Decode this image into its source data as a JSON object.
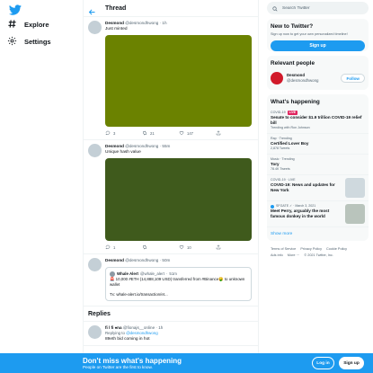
{
  "nav": {
    "logo_icon": "twitter-bird-icon",
    "items": [
      {
        "label": "Explore",
        "icon": "hashtag-icon"
      },
      {
        "label": "Settings",
        "icon": "gear-icon"
      }
    ]
  },
  "header": {
    "title": "Thread"
  },
  "tweets": [
    {
      "name": "Desmond",
      "handle": "@desmondhwong",
      "time": "1h",
      "text": "Just minted",
      "media_color": "#6b8200",
      "replies": "3",
      "retweets": "21",
      "likes": "147"
    },
    {
      "name": "Desmond",
      "handle": "@desmondhwong",
      "time": "55m",
      "text": "Unique hash value",
      "media_color": "#3f5a1c",
      "replies": "1",
      "retweets": "",
      "likes": "10"
    },
    {
      "name": "Desmond",
      "handle": "@desmondhwong",
      "time": "50m",
      "quote": {
        "name": "Whale Alert",
        "handle": "@whale_alert",
        "time": "51m",
        "text": "🚨 10,000 #ETH (14,888,109 USD) transferred from #Binance🤑 to unknown wallet",
        "link": "Tx: whale-alert.io/transaction/et..."
      }
    }
  ],
  "replies_section": {
    "title": "Replies",
    "items": [
      {
        "name": "fi l fi ♠na",
        "handle": "@fionajs__online",
        "time": "1h",
        "replying_label": "Replying to",
        "replying_to": "@desmondhwong",
        "text": "89eth bid coming in hot"
      }
    ]
  },
  "search": {
    "placeholder": "Search Twitter"
  },
  "new_to_twitter": {
    "title": "New to Twitter?",
    "sub": "Sign up now to get your own personalized timeline!",
    "button": "Sign up"
  },
  "relevant": {
    "title": "Relevant people",
    "person": {
      "name": "Desmond",
      "handle": "@desmondhwong",
      "button": "Follow"
    }
  },
  "happening": {
    "title": "What's happening",
    "trends": [
      {
        "context": "COVID-19",
        "live": "LIVE",
        "title": "Senate to consider $1.9 trillion COVID-19 relief bill",
        "extra": "Trending with Ron Johnson"
      },
      {
        "context": "Rap · Trending",
        "title": "Certified Lover Boy",
        "extra": "2,878 Tweets"
      },
      {
        "context": "Music · Trending",
        "title": "Tory",
        "extra": "78.4K Tweets"
      },
      {
        "context": "COVID-19 · LIVE",
        "title": "COVID-19: News and updates for New York",
        "extra": ""
      },
      {
        "context": "SFGATE ✓ · March 3, 2021",
        "title": "Meet Perry, arguably the most famous donkey in the world",
        "extra": ""
      }
    ],
    "show_more": "Show more"
  },
  "footer": {
    "links": [
      "Terms of Service",
      "Privacy Policy",
      "Cookie Policy",
      "Ads info",
      "More ···",
      "© 2021 Twitter, Inc."
    ]
  },
  "banner": {
    "title": "Don't miss what's happening",
    "sub": "People on Twitter are the first to know.",
    "login": "Log in",
    "signup": "Sign up"
  }
}
